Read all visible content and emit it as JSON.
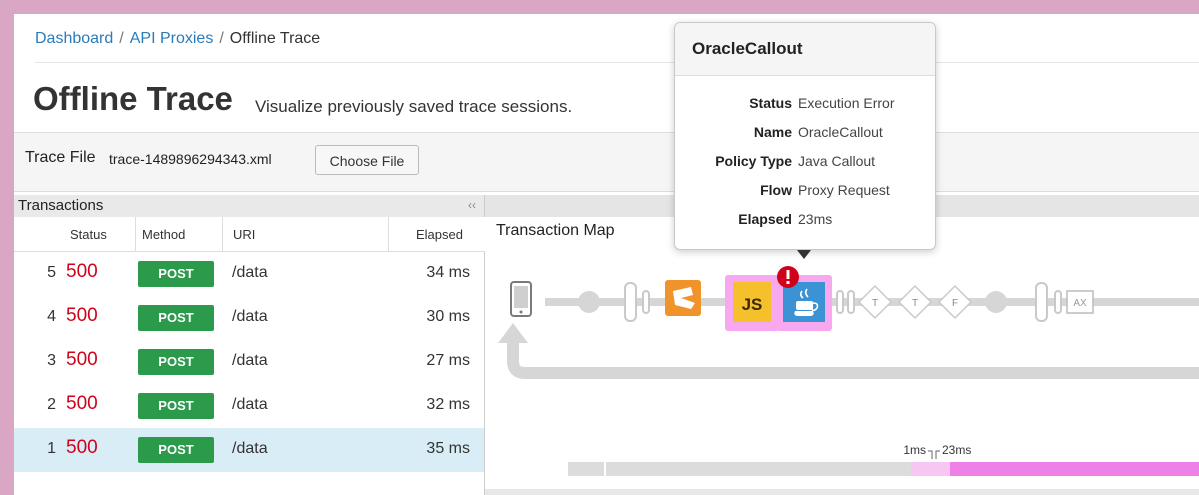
{
  "breadcrumb": {
    "items": [
      "Dashboard",
      "API Proxies"
    ],
    "current": "Offline Trace",
    "separator": "/"
  },
  "page": {
    "title": "Offline Trace",
    "subtitle": "Visualize previously saved trace sessions."
  },
  "trace_file": {
    "label": "Trace File",
    "filename": "trace-1489896294343.xml",
    "choose_button": "Choose File"
  },
  "transactions": {
    "title": "Transactions",
    "collapse_icon": "double-chevron-left-icon",
    "columns": [
      "Status",
      "Method",
      "URI",
      "Elapsed"
    ],
    "rows": [
      {
        "num": "5",
        "status": "500",
        "method": "POST",
        "uri": "/data",
        "elapsed": "34 ms",
        "selected": false
      },
      {
        "num": "4",
        "status": "500",
        "method": "POST",
        "uri": "/data",
        "elapsed": "30 ms",
        "selected": false
      },
      {
        "num": "3",
        "status": "500",
        "method": "POST",
        "uri": "/data",
        "elapsed": "27 ms",
        "selected": false
      },
      {
        "num": "2",
        "status": "500",
        "method": "POST",
        "uri": "/data",
        "elapsed": "32 ms",
        "selected": false
      },
      {
        "num": "1",
        "status": "500",
        "method": "POST",
        "uri": "/data",
        "elapsed": "35 ms",
        "selected": true
      }
    ]
  },
  "map": {
    "title": "Transaction Map",
    "policies": [
      {
        "name": "js-policy",
        "label": "JS"
      },
      {
        "name": "condition-t-1",
        "label": "T"
      },
      {
        "name": "condition-t-2",
        "label": "T"
      },
      {
        "name": "condition-f",
        "label": "F"
      },
      {
        "name": "assign-message",
        "label": "AX"
      }
    ],
    "timeline": {
      "label_left": "1ms",
      "label_right": "23ms"
    },
    "colors": {
      "highlight": "#f7a8ee",
      "timeline_active": "#ee80e8",
      "timeline_light": "#f7c6f3",
      "track": "#d6d6d6",
      "js": "#f5c02c",
      "java": "#3b93d6",
      "extract": "#f0932b",
      "error": "#d0021b"
    }
  },
  "popover": {
    "title": "OracleCallout",
    "fields": [
      {
        "key": "Status",
        "value": "Execution Error"
      },
      {
        "key": "Name",
        "value": "OracleCallout"
      },
      {
        "key": "Policy Type",
        "value": "Java Callout"
      },
      {
        "key": "Flow",
        "value": "Proxy Request"
      },
      {
        "key": "Elapsed",
        "value": "23ms"
      }
    ]
  }
}
